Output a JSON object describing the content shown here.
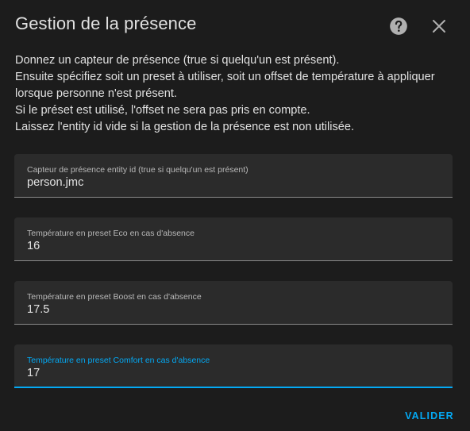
{
  "dialog": {
    "title": "Gestion de la présence",
    "help_icon": "help-circle-icon",
    "close_icon": "close-icon"
  },
  "description": {
    "lines": [
      "Donnez un capteur de présence (true si quelqu'un est présent).",
      "Ensuite spécifiez soit un preset à utiliser, soit un offset de température à appliquer",
      "lorsque personne n'est présent.",
      "Si le préset est utilisé, l'offset ne sera pas pris en compte.",
      "Laissez l'entity id vide si la gestion de la présence est non utilisée."
    ]
  },
  "fields": [
    {
      "label": "Capteur de présence entity id (true si quelqu'un est présent)",
      "value": "person.jmc",
      "focused": false
    },
    {
      "label": "Température en preset Eco en cas d'absence",
      "value": "16",
      "focused": false
    },
    {
      "label": "Température en preset Boost en cas d'absence",
      "value": "17.5",
      "focused": false
    },
    {
      "label": "Température en preset Comfort en cas d'absence",
      "value": "17",
      "focused": true
    }
  ],
  "actions": {
    "validate_label": "VALIDER"
  },
  "colors": {
    "background": "#1c1c1c",
    "field_background": "#2b2b2b",
    "accent": "#03a9f4",
    "text": "#e1e1e1",
    "label": "#b8b8b8",
    "icon": "#b0b0b0"
  }
}
